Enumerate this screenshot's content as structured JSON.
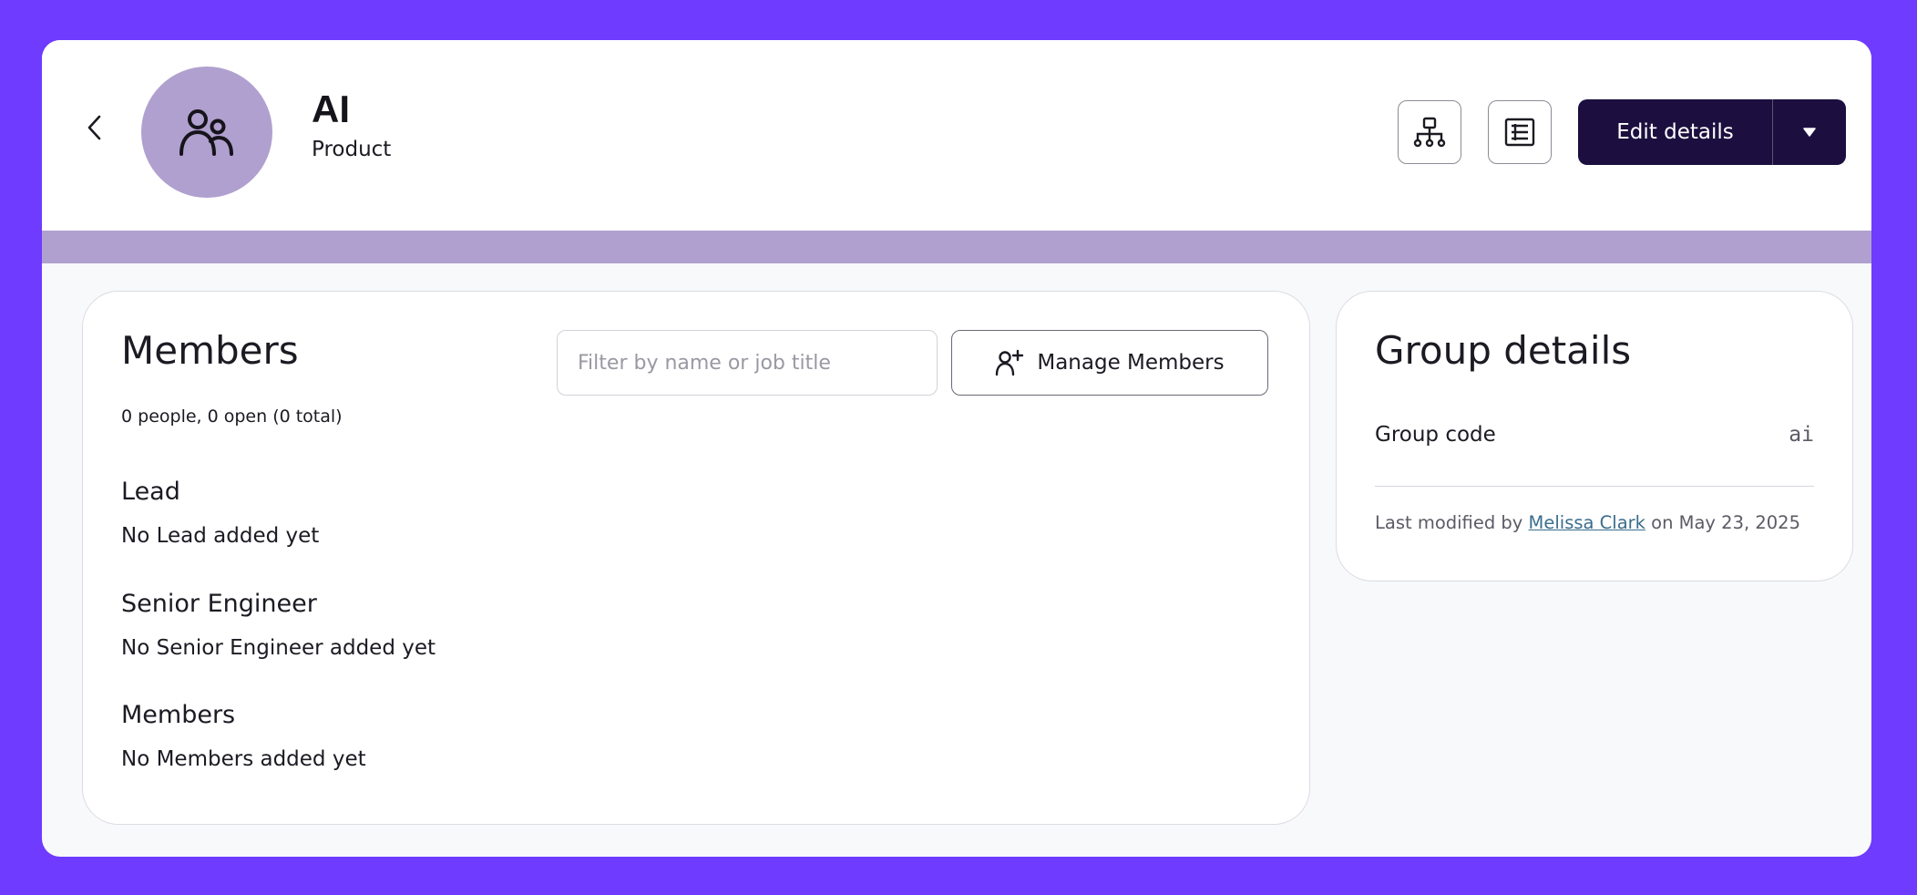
{
  "header": {
    "group_name": "AI",
    "group_subtitle": "Product",
    "edit_label": "Edit details"
  },
  "members": {
    "title": "Members",
    "count_text": "0 people, 0 open (0 total)",
    "filter_placeholder": "Filter by name or job title",
    "filter_value": "",
    "manage_label": "Manage Members",
    "roles": [
      {
        "heading": "Lead",
        "empty_text": "No Lead added yet"
      },
      {
        "heading": "Senior Engineer",
        "empty_text": "No Senior Engineer added yet"
      },
      {
        "heading": "Members",
        "empty_text": "No Members added yet"
      }
    ]
  },
  "details": {
    "title": "Group details",
    "group_code_label": "Group code",
    "group_code_value": "ai",
    "modified_prefix": "Last modified by",
    "modified_by": "Melissa Clark",
    "modified_suffix": "on May 23, 2025"
  },
  "icons": {
    "back": "chevron-left-icon",
    "avatar": "people-icon",
    "org_chart": "org-chart-icon",
    "list": "list-icon",
    "caret": "caret-down-icon",
    "add_user": "add-user-icon"
  },
  "colors": {
    "frame": "#6e3bff",
    "accent": "#b0a0cf",
    "primary_button": "#1c0f3f",
    "link": "#3a6d8c"
  }
}
